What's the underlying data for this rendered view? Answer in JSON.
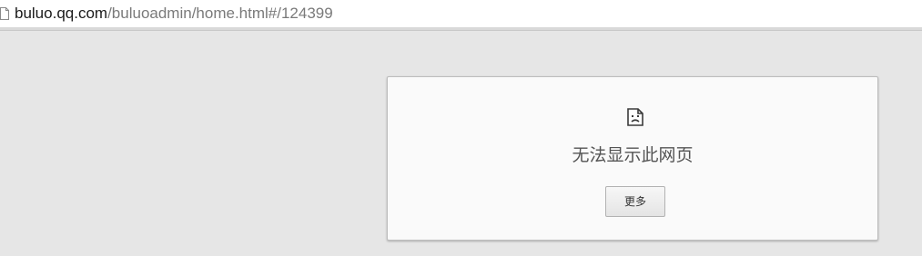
{
  "address_bar": {
    "url_host": "buluo.qq.com",
    "url_path": "/buluoadmin/home.html#/124399",
    "page_icon": "page-icon"
  },
  "error_page": {
    "icon": "sad-page-icon",
    "message": "无法显示此网页",
    "more_button_label": "更多"
  }
}
